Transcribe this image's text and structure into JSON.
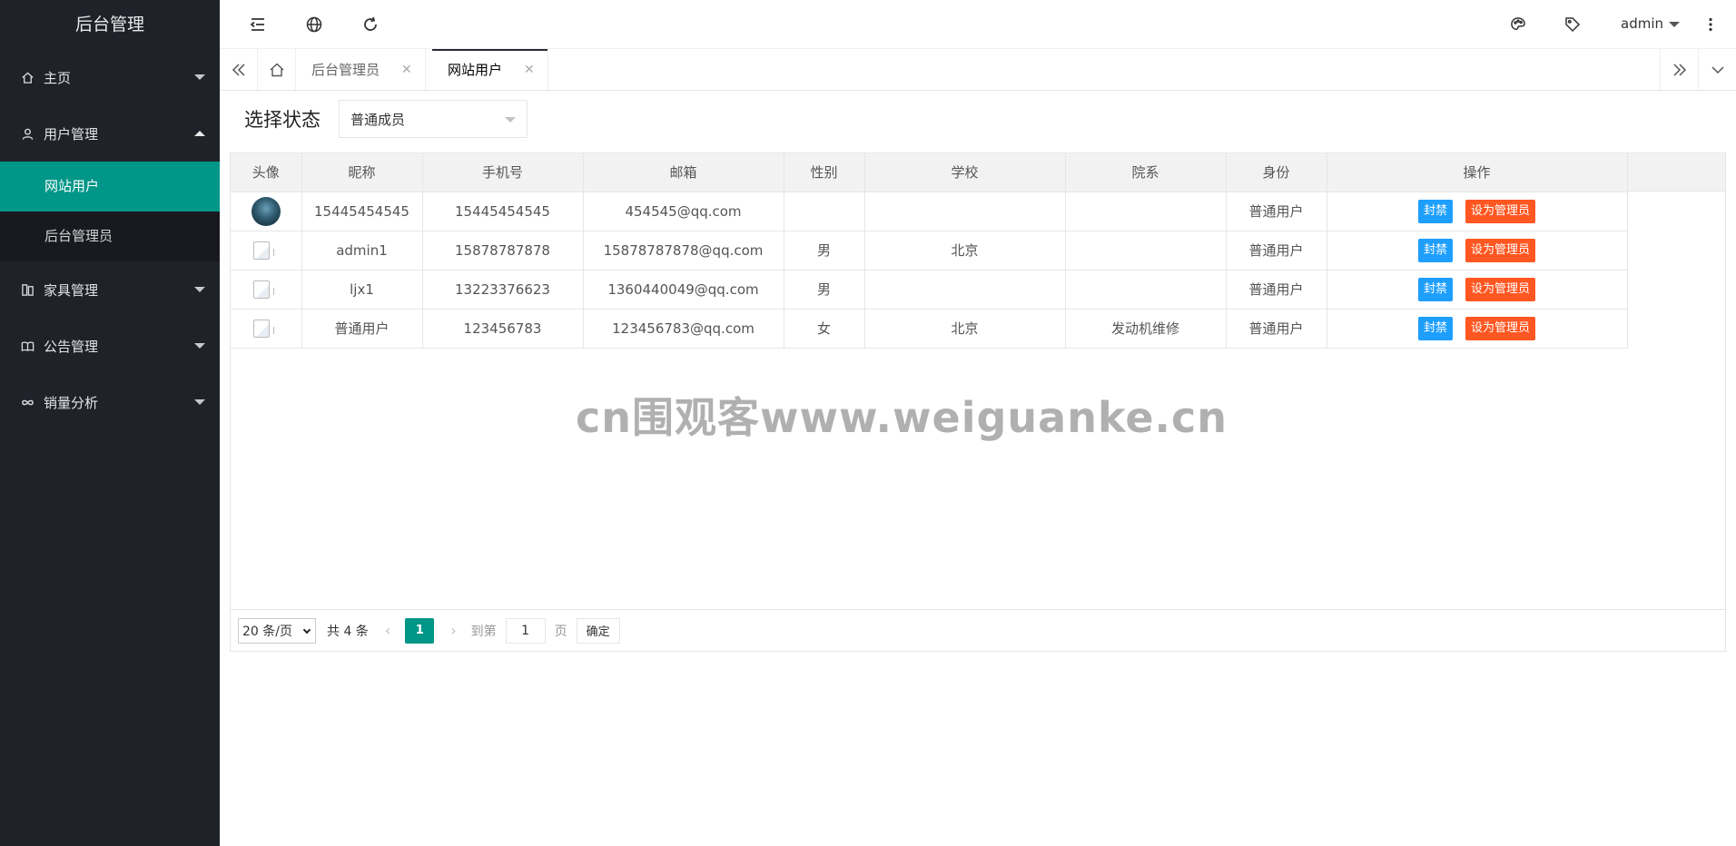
{
  "app": {
    "title": "后台管理"
  },
  "sidebar": {
    "items": [
      {
        "label": "主页",
        "icon": "home-icon",
        "expanded": false
      },
      {
        "label": "用户管理",
        "icon": "user-icon",
        "expanded": true,
        "children": [
          {
            "label": "网站用户",
            "active": true
          },
          {
            "label": "后台管理员",
            "active": false
          }
        ]
      },
      {
        "label": "家具管理",
        "icon": "furniture-icon",
        "expanded": false
      },
      {
        "label": "公告管理",
        "icon": "book-icon",
        "expanded": false
      },
      {
        "label": "销量分析",
        "icon": "infinity-icon",
        "expanded": false
      }
    ]
  },
  "header": {
    "icons": [
      "menu-toggle-icon",
      "globe-icon",
      "refresh-icon",
      "palette-icon",
      "tag-icon",
      "more-vertical-icon"
    ],
    "username": "admin"
  },
  "tabs": [
    {
      "label": "后台管理员",
      "active": false
    },
    {
      "label": "网站用户",
      "active": true
    }
  ],
  "filter": {
    "label": "选择状态",
    "selected": "普通成员"
  },
  "table": {
    "columns": [
      "头像",
      "昵称",
      "手机号",
      "邮箱",
      "性别",
      "学校",
      "院系",
      "身份",
      "操作"
    ],
    "rows": [
      {
        "avatar": "photo",
        "nickname": "15445454545",
        "phone": "15445454545",
        "email": "454545@qq.com",
        "gender": "",
        "school": "",
        "department": "",
        "role": "普通用户"
      },
      {
        "avatar": "broken",
        "nickname": "admin1",
        "phone": "15878787878",
        "email": "15878787878@qq.com",
        "gender": "男",
        "school": "北京",
        "department": "",
        "role": "普通用户"
      },
      {
        "avatar": "broken",
        "nickname": "ljx1",
        "phone": "13223376623",
        "email": "1360440049@qq.com",
        "gender": "男",
        "school": "",
        "department": "",
        "role": "普通用户"
      },
      {
        "avatar": "broken",
        "nickname": "普通用户",
        "phone": "123456783",
        "email": "123456783@qq.com",
        "gender": "女",
        "school": "北京",
        "department": "发动机维修",
        "role": "普通用户"
      }
    ],
    "actions": {
      "ban": "封禁",
      "make_admin": "设为管理员"
    }
  },
  "pagination": {
    "limit": "20 条/页",
    "total": "共 4 条",
    "current_page": "1",
    "goto_label": "到第",
    "goto_value": "1",
    "page_unit": "页",
    "confirm": "确定"
  },
  "watermark": "cn围观客www.weiguanke.cn",
  "colors": {
    "sidebar": "#20222a",
    "accent": "#009688",
    "ban": "#1e9fff",
    "admin": "#ff5722"
  }
}
